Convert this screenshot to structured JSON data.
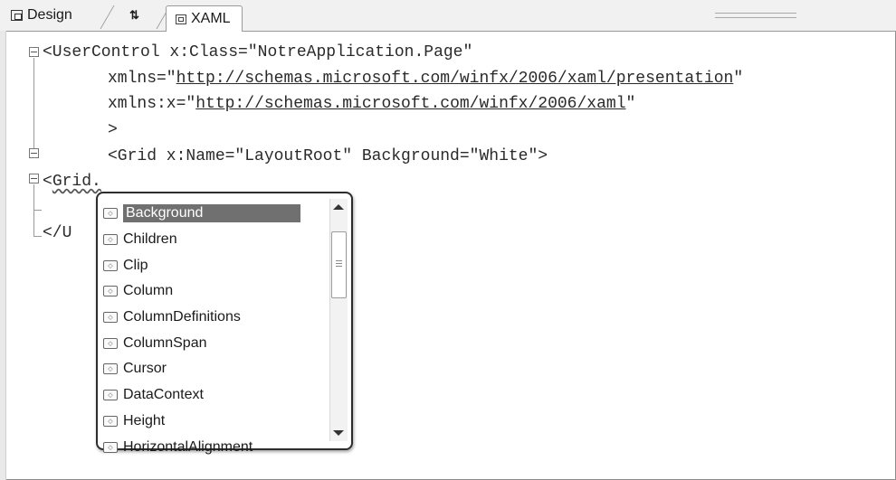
{
  "tabs": {
    "design": "Design",
    "swap": "⇅",
    "xaml": "XAML"
  },
  "code": {
    "l1": "<UserControl x:Class=\"NotreApplication.Page\"",
    "l2_pre": "xmlns=\"",
    "l2_url": "http://schemas.microsoft.com/winfx/2006/xaml/presentation",
    "l2_post": "\"",
    "l3_pre": "xmlns:x=\"",
    "l3_url": "http://schemas.microsoft.com/winfx/2006/xaml",
    "l3_post": "\"",
    "l4": ">",
    "l5": "<Grid x:Name=\"LayoutRoot\" Background=\"White\">",
    "l6_pre": "<",
    "l6_grid": "Grid.",
    "l7": "</U"
  },
  "completion": {
    "items": [
      "Background",
      "Children",
      "Clip",
      "Column",
      "ColumnDefinitions",
      "ColumnSpan",
      "Cursor",
      "DataContext",
      "Height",
      "HorizontalAlignment"
    ],
    "selected": "Background",
    "icon": "property-icon"
  }
}
